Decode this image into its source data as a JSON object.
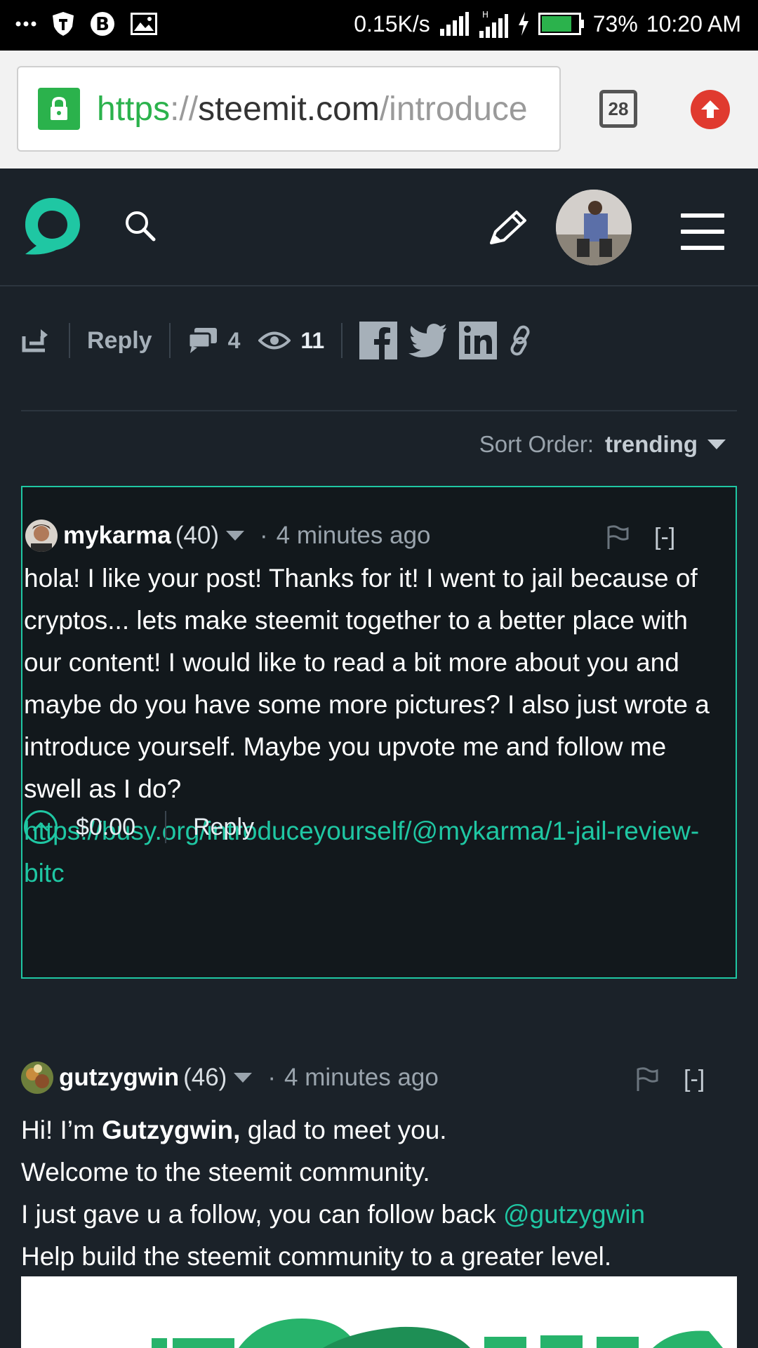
{
  "status_bar": {
    "speed": "0.15K/s",
    "battery": "73%",
    "time": "10:20 AM",
    "icons": [
      "more-dots-icon",
      "shield-app-icon",
      "bitcoin-app-icon",
      "gallery-icon",
      "signal-icon",
      "signal-icon",
      "charging-icon",
      "battery-icon"
    ]
  },
  "browser": {
    "url_scheme": "https",
    "url_sep": "://",
    "url_host": "steemit.com",
    "url_path": "/introduce",
    "tab_count": "28"
  },
  "colors": {
    "accent": "#1fc7a3",
    "header_bg": "#1b2229",
    "highlight_bg": "#12181c"
  },
  "action_bar": {
    "reply_label": "Reply",
    "comments_count": "4",
    "views_count": "11",
    "share_icons": [
      "facebook-icon",
      "twitter-icon",
      "linkedin-icon",
      "link-icon"
    ]
  },
  "sort": {
    "label": "Sort Order:",
    "value": "trending"
  },
  "comments": [
    {
      "author": "mykarma",
      "reputation": "(40)",
      "dot": "·",
      "time": "4 minutes ago",
      "collapse": "[-]",
      "body": "hola! I like your post! Thanks for it! I went to jail because of cryptos... lets make steemit together to a better place with our content! I would like to read a bit more about you and maybe do you have some more pictures? I also just wrote a introduce yourself. Maybe you upvote me and follow me swell as I do?",
      "link": "https://busy.org/introduceyourself/@mykarma/1-jail-review-bitc",
      "payout": "$0.00",
      "reply_label": "Reply"
    },
    {
      "author": "gutzygwin",
      "reputation": "(46)",
      "dot": "·",
      "time": "4 minutes ago",
      "collapse": "[-]",
      "line1_pre": "Hi! I’m ",
      "line1_bold": "Gutzygwin,",
      "line1_post": " glad to meet you.",
      "line2": "Welcome to the steemit community.",
      "line3_pre": "I just gave u a follow, you can follow back ",
      "line3_link": "@gutzygwin",
      "line4": "Help build the steemit community to a greater level."
    }
  ]
}
